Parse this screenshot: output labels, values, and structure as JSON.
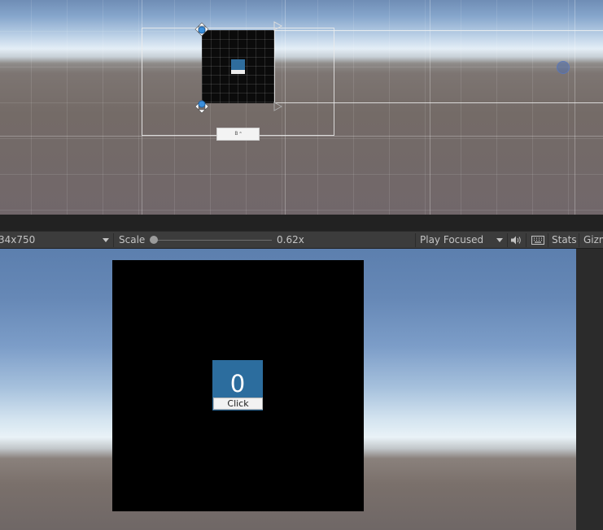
{
  "scene_view": {
    "mini_button_text": "B ᵃ"
  },
  "game_toolbar": {
    "resolution": "34x750",
    "scale_label": "Scale",
    "scale_value": "0.62x",
    "play_mode": "Play Focused",
    "stats_label": "Stats",
    "gizmos_label": "Gizm"
  },
  "game_view": {
    "counter": "0",
    "button_label": "Click"
  },
  "colors": {
    "accent_blue": "#2c6d9e",
    "handle_blue": "#3b8fdc"
  }
}
